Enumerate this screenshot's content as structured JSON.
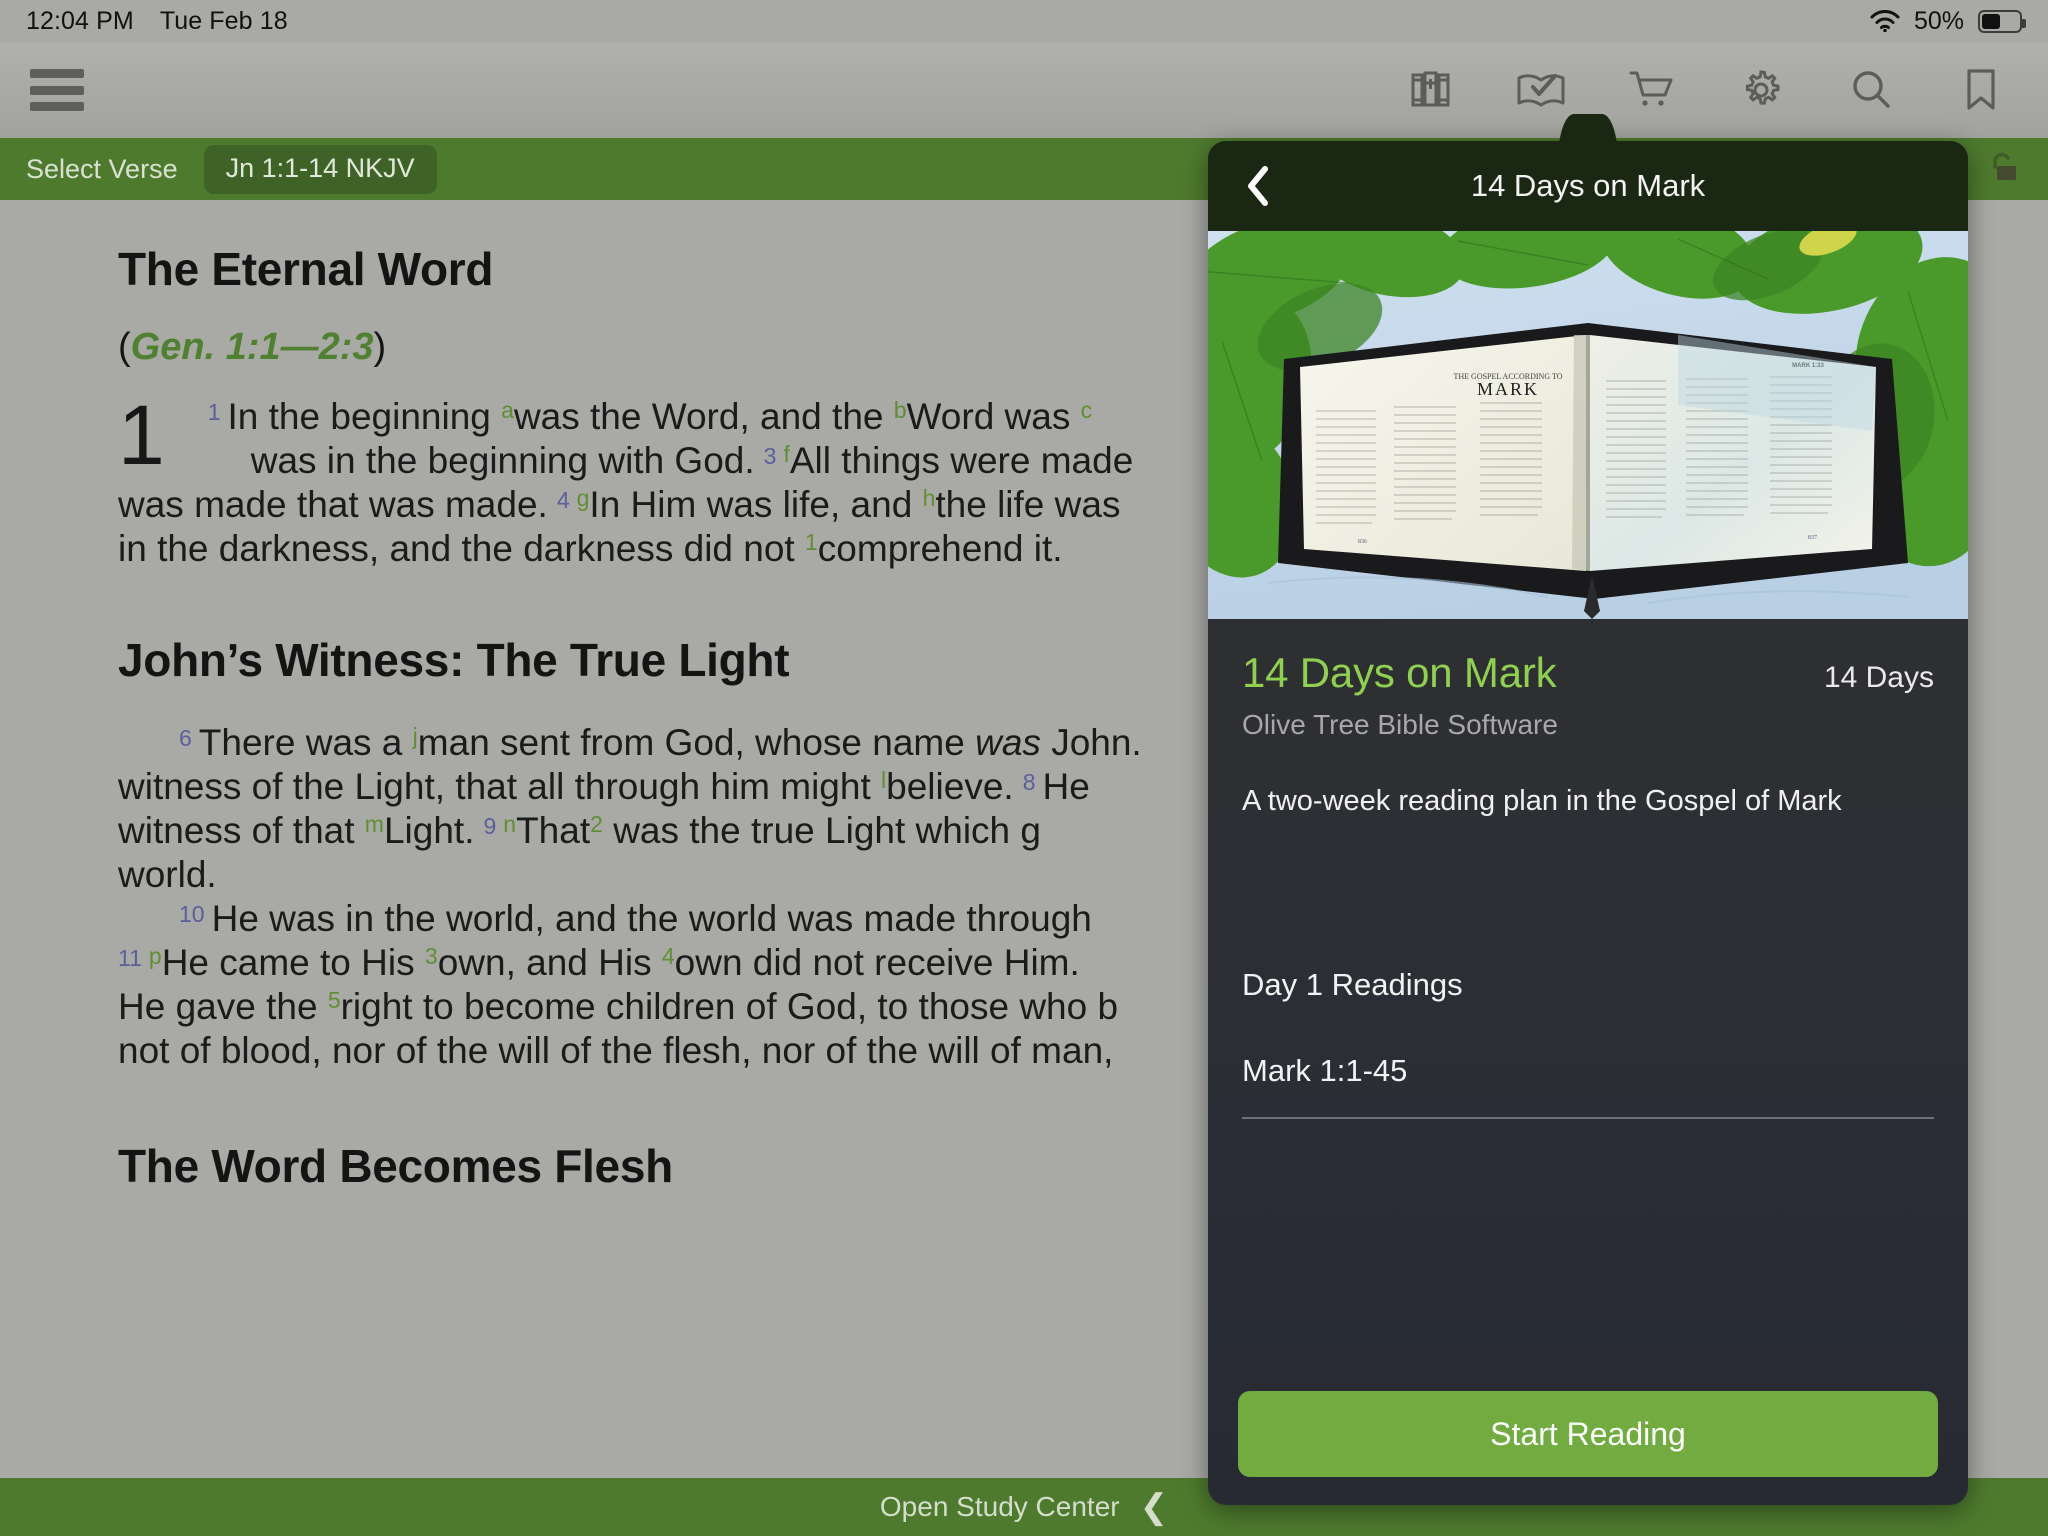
{
  "status_bar": {
    "time": "12:04 PM",
    "date": "Tue Feb 18",
    "battery_percent": "50%",
    "wifi_icon": "wifi-icon",
    "battery_icon": "battery-icon"
  },
  "toolbar": {
    "menu_icon": "hamburger-menu-icon",
    "icons": [
      {
        "name": "library-books-icon",
        "label": "Library"
      },
      {
        "name": "reading-plan-icon",
        "label": "Reading Plans"
      },
      {
        "name": "shopping-cart-icon",
        "label": "Store"
      },
      {
        "name": "gear-icon",
        "label": "Settings"
      },
      {
        "name": "search-icon",
        "label": "Search"
      },
      {
        "name": "bookmark-icon",
        "label": "Bookmarks"
      }
    ]
  },
  "verse_bar": {
    "select_verse_label": "Select Verse",
    "reference_chip": "Jn 1:1-14 NKJV",
    "lock_icon": "unlocked-padlock-icon",
    "background_color": "#4e7a2e"
  },
  "reader": {
    "heading_1": "The Eternal Word",
    "cross_reference_open": "(",
    "cross_reference": "Gen. 1:1—2:3",
    "cross_reference_close": ")",
    "chapter_number": "1",
    "verse_1_num": "1",
    "verse_1_a": "In the beginning ",
    "fn_a": "a",
    "verse_1_b": "was the Word, and the ",
    "fn_b": "b",
    "verse_1_c": "Word was ",
    "fn_c": "c",
    "verse_2_tail": "was in the beginning with God.",
    "verse_3_num": "3",
    "fn_f": "f",
    "verse_3_a": "All things were made",
    "verse_3_b": "was made that was made.",
    "verse_4_num": "4",
    "fn_g": "g",
    "verse_4_a": "In Him was life, and ",
    "fn_h": "h",
    "verse_4_b": "the life was",
    "verse_5_tail": "in the darkness, and the darkness did not ",
    "fn_1": "1",
    "verse_5_end": "comprehend it.",
    "heading_2": "John’s Witness: The True Light",
    "verse_6_num": "6",
    "verse_6_a": "There was a ",
    "fn_j": "j",
    "verse_6_b": "man sent from God, whose name ",
    "verse_6_was": "was",
    "verse_6_c": " John.",
    "verse_7_a": "witness of the Light, that all through him might ",
    "fn_l": "l",
    "verse_7_b": "believe.",
    "verse_8_num": "8",
    "verse_8_a": "He",
    "verse_8_b": "witness of that ",
    "fn_m": "m",
    "verse_8_c": "Light.",
    "verse_9_num": "9",
    "fn_n": "n",
    "verse_9_a": "That",
    "fn_2": "2",
    "verse_9_b": " was the true Light which g",
    "verse_9_c": "world.",
    "verse_10_num": "10",
    "verse_10": "He was in the world, and the world was made through",
    "verse_11_num": "11",
    "fn_p": "p",
    "verse_11_a": "He came to His ",
    "fn_3": "3",
    "verse_11_b": "own, and His ",
    "fn_4": "4",
    "verse_11_c": "own did not receive Him.",
    "verse_12_a": "He gave the ",
    "fn_5": "5",
    "verse_12_b": "right to become children of God, to those who b",
    "verse_13": "not of blood, nor of the will of the flesh, nor of the will of man,",
    "heading_3": "The Word Becomes Flesh"
  },
  "study_bar": {
    "label": "Open Study Center",
    "chevron_icon": "chevron-left-icon"
  },
  "popover": {
    "header_title": "14 Days on Mark",
    "back_icon": "chevron-left-icon",
    "hero_image_alt": "open-bible-on-leaves-photo",
    "plan_title": "14 Days on Mark",
    "plan_duration": "14 Days",
    "publisher": "Olive Tree Bible Software",
    "description": "A two-week reading plan in the Gospel of Mark",
    "readings_heading": "Day 1 Readings",
    "readings": [
      "Mark 1:1-45"
    ],
    "start_button": "Start Reading",
    "accent_color": "#8fd14f",
    "button_color": "#72ab3f"
  }
}
